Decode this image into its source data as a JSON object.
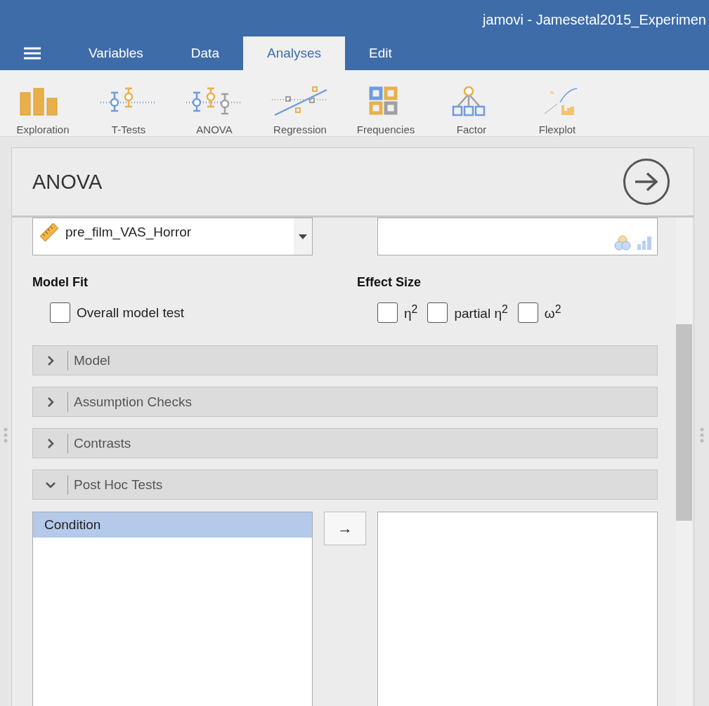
{
  "window": {
    "title": "jamovi - Jamesetal2015_Experimen"
  },
  "tabs": [
    {
      "label": "Variables",
      "selected": false
    },
    {
      "label": "Data",
      "selected": false
    },
    {
      "label": "Analyses",
      "selected": true
    },
    {
      "label": "Edit",
      "selected": false
    }
  ],
  "toolbar": [
    {
      "label": "Exploration",
      "kind": "bars"
    },
    {
      "label": "T-Tests",
      "kind": "ttest"
    },
    {
      "label": "ANOVA",
      "kind": "anova"
    },
    {
      "label": "Regression",
      "kind": "regression"
    },
    {
      "label": "Frequencies",
      "kind": "frequencies"
    },
    {
      "label": "Factor",
      "kind": "factor"
    },
    {
      "label": "Flexplot",
      "kind": "flexplot"
    }
  ],
  "panel": {
    "title": "ANOVA",
    "variable_list": {
      "items": [
        "pre_film_VAS_Horror"
      ]
    },
    "model_fit": {
      "heading": "Model Fit",
      "options": [
        {
          "label": "Overall model test",
          "checked": false
        }
      ]
    },
    "effect_size": {
      "heading": "Effect Size",
      "options": [
        {
          "label": "η$^{2}$",
          "checked": false
        },
        {
          "label": "partial η$^{2}$",
          "checked": false
        },
        {
          "label": "ω$^{2}$",
          "checked": false
        }
      ]
    },
    "sections": [
      {
        "label": "Model",
        "expanded": false
      },
      {
        "label": "Assumption Checks",
        "expanded": false
      },
      {
        "label": "Contrasts",
        "expanded": false
      },
      {
        "label": "Post Hoc Tests",
        "expanded": true
      }
    ],
    "post_hoc": {
      "available": [
        {
          "label": "Condition",
          "selected": true
        }
      ],
      "move_button": "→"
    }
  }
}
